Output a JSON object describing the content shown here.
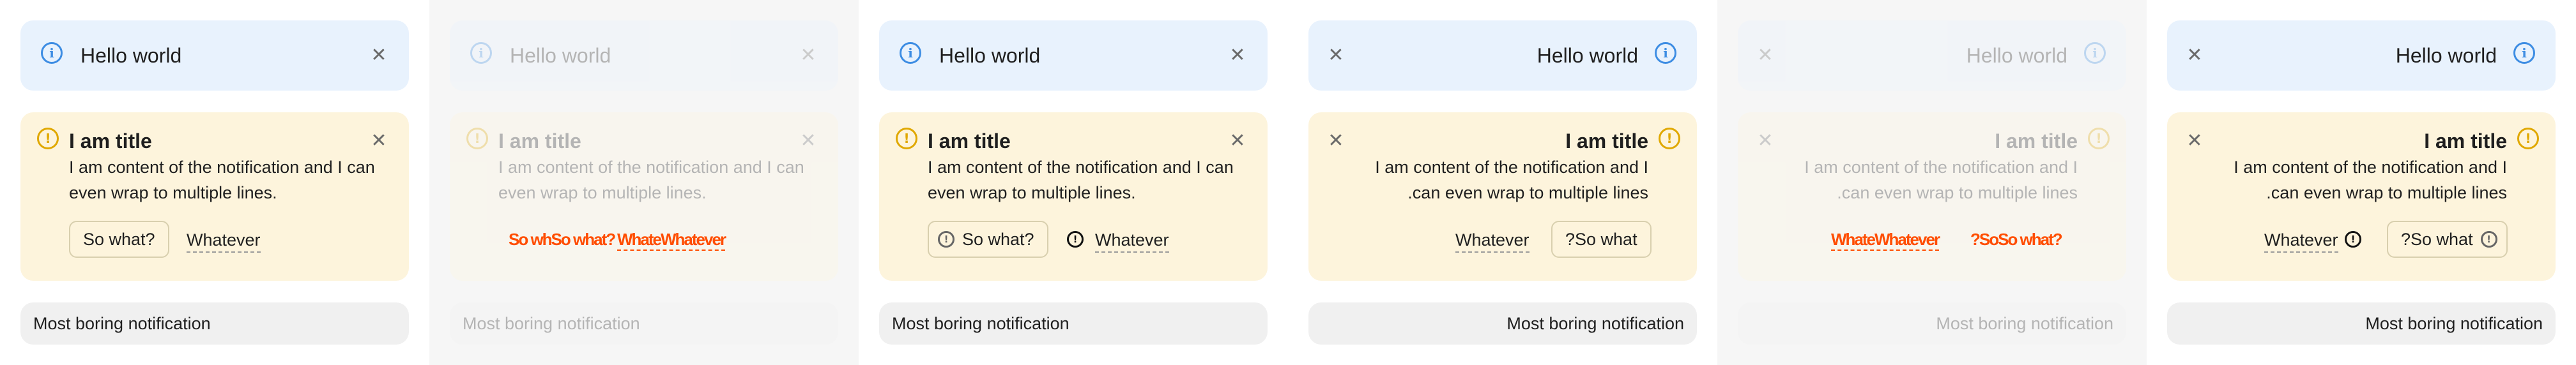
{
  "notifications": {
    "info_text": "Hello world",
    "warn_title": "I am title",
    "warn_body_ltr": "I am content of the notification and I can even wrap to multiple lines.",
    "warn_body_rtl_1": "I am content of the notification and I",
    "warn_body_rtl_2": ".can even wrap to multiple lines",
    "button_primary": "So what?",
    "button_primary_rtl": "?So what",
    "button_link": "Whatever",
    "boring_text": "Most boring notification"
  },
  "overlay": {
    "glitch_1": "So whSo what?",
    "glitch_2": "WhateWhatever",
    "glitch_3": "WhateWhatever",
    "glitch_4": "?SoSo what?"
  },
  "icons": {
    "info": "info-icon",
    "warning": "warning-icon",
    "close": "close-icon"
  },
  "colors": {
    "info_bg": "#e8f2fd",
    "warn_bg": "#fdf4dc",
    "boring_bg": "#f0f0f0",
    "info_accent": "#3d8de3",
    "warn_accent": "#e0a800"
  }
}
